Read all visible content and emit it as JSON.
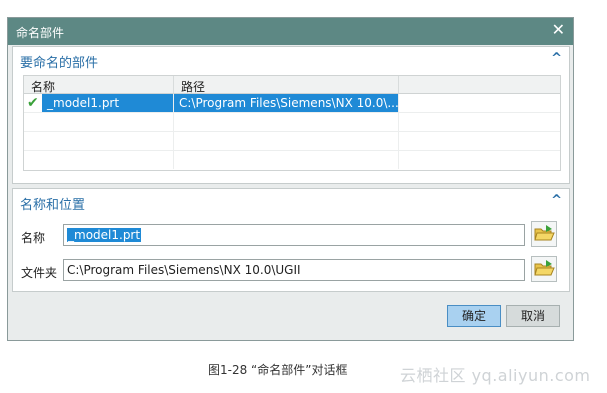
{
  "dialog": {
    "title": "命名部件",
    "close_glyph": "✕"
  },
  "parts_section": {
    "title": "要命名的部件",
    "collapse_glyph": "^",
    "columns": [
      "名称",
      "路径"
    ],
    "rows": [
      {
        "status_glyph": "✔",
        "name": "_model1.prt",
        "path": "C:\\Program Files\\Siemens\\NX 10.0\\..."
      }
    ]
  },
  "location_section": {
    "title": "名称和位置",
    "collapse_glyph": "^",
    "name_label": "名称",
    "name_value": "_model1.prt",
    "folder_label": "文件夹",
    "folder_value": "C:\\Program Files\\Siemens\\NX 10.0\\UGII"
  },
  "buttons": {
    "ok": "确定",
    "cancel": "取消"
  },
  "caption": "图1-28 “命名部件”对话框",
  "watermark": "云栖社区 yq.aliyun.com",
  "colors": {
    "titlebar": "#5d8884",
    "accent_text": "#2a6fa7",
    "selection": "#1f8ad6",
    "check": "#3aa13a"
  },
  "icons": [
    "close-icon",
    "chevron-up-icon",
    "check-icon",
    "folder-open-icon"
  ]
}
